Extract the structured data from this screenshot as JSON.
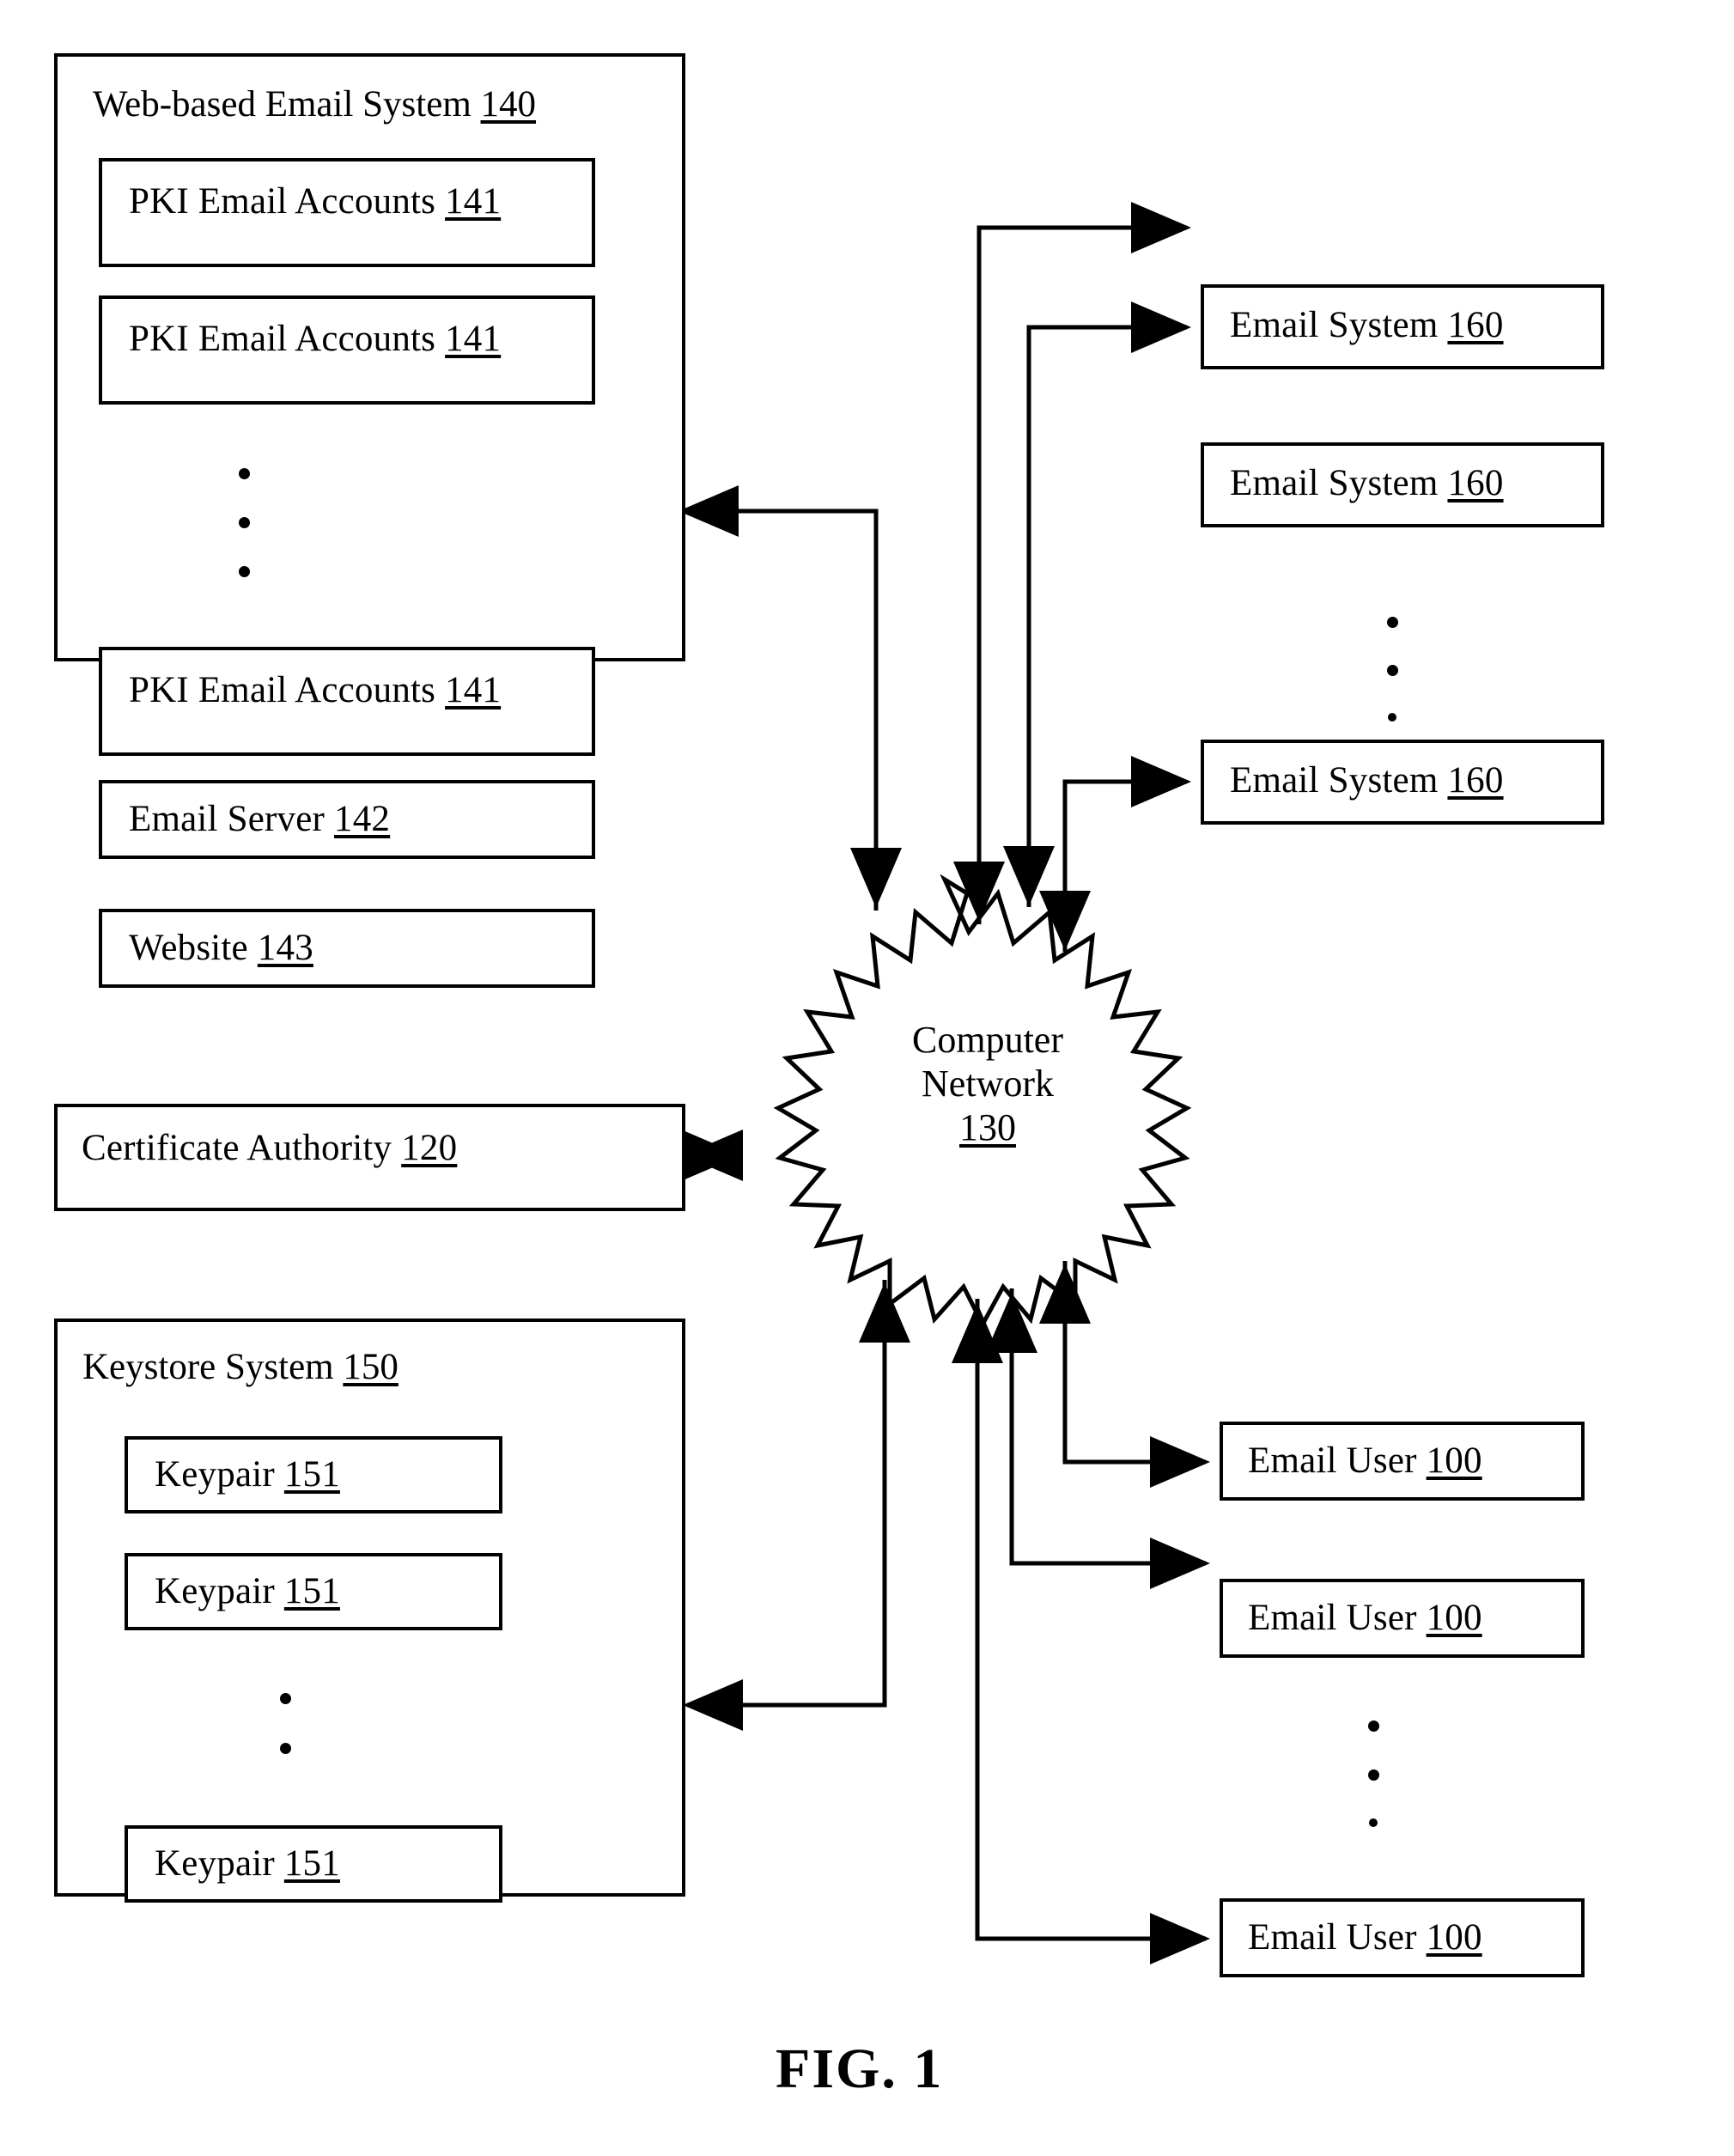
{
  "figure": {
    "caption": "FIG. 1"
  },
  "web_email_system": {
    "title_text": "Web-based Email System",
    "title_num": "140",
    "pki_accounts": [
      {
        "text": "PKI Email Accounts",
        "num": "141"
      },
      {
        "text": "PKI Email Accounts",
        "num": "141"
      },
      {
        "text": "PKI Email Accounts",
        "num": "141"
      }
    ],
    "email_server": {
      "text": "Email Server",
      "num": "142"
    },
    "website": {
      "text": "Website",
      "num": "143"
    },
    "ellipsis_dots": 3
  },
  "certificate_authority": {
    "text": "Certificate Authority",
    "num": "120"
  },
  "keystore_system": {
    "title_text": "Keystore System",
    "title_num": "150",
    "keypairs": [
      {
        "text": "Keypair",
        "num": "151"
      },
      {
        "text": "Keypair",
        "num": "151"
      },
      {
        "text": "Keypair",
        "num": "151"
      }
    ],
    "ellipsis_dots": 2
  },
  "network": {
    "line1": "Computer",
    "line2": "Network",
    "num": "130",
    "shape": "starburst-cloud-icon"
  },
  "email_systems": [
    {
      "text": "Email System",
      "num": "160"
    },
    {
      "text": "Email System",
      "num": "160"
    },
    {
      "text": "Email System",
      "num": "160"
    }
  ],
  "email_systems_ellipsis_dots": 3,
  "email_users": [
    {
      "text": "Email User",
      "num": "100"
    },
    {
      "text": "Email User",
      "num": "100"
    },
    {
      "text": "Email User",
      "num": "100"
    }
  ],
  "email_users_ellipsis_dots": 3,
  "colors": {
    "ink": "#000000",
    "paper": "#ffffff"
  }
}
